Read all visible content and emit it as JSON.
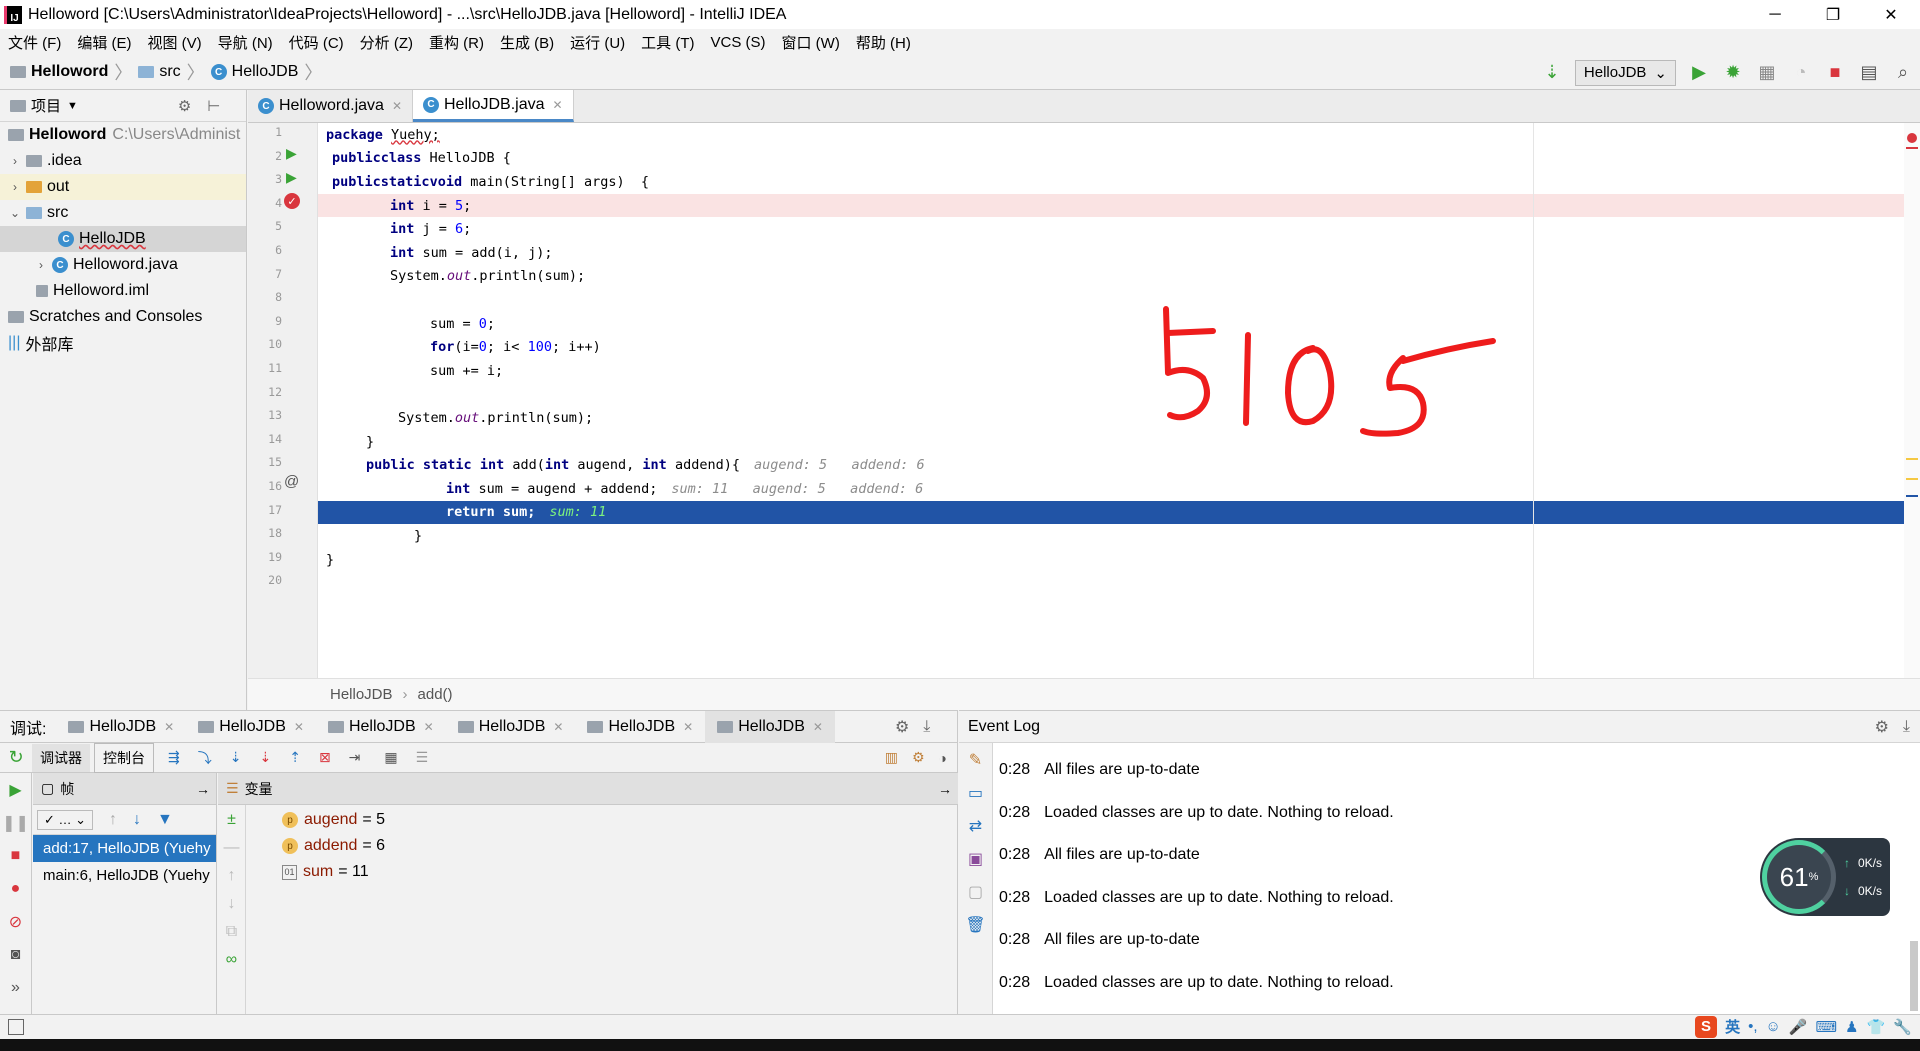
{
  "window": {
    "title": "Helloword [C:\\Users\\Administrator\\IdeaProjects\\Helloword] - ...\\src\\HelloJDB.java [Helloword] - IntelliJ IDEA"
  },
  "menu": [
    "文件 (F)",
    "编辑 (E)",
    "视图 (V)",
    "导航 (N)",
    "代码 (C)",
    "分析 (Z)",
    "重构 (R)",
    "生成 (B)",
    "运行 (U)",
    "工具 (T)",
    "VCS (S)",
    "窗口 (W)",
    "帮助 (H)"
  ],
  "breadcrumb": {
    "project": "Helloword",
    "folder": "src",
    "file": "HelloJDB"
  },
  "toolbar": {
    "run_config": "HelloJDB"
  },
  "project_panel": {
    "title": "项目",
    "items": [
      {
        "label": "Helloword",
        "hint": "C:\\Users\\Administ"
      },
      {
        "label": ".idea"
      },
      {
        "label": "out"
      },
      {
        "label": "src"
      },
      {
        "label": "HelloJDB"
      },
      {
        "label": "Helloword.java"
      },
      {
        "label": "Helloword.iml"
      },
      {
        "label": "Scratches and Consoles"
      },
      {
        "label": "外部库"
      }
    ]
  },
  "editor": {
    "tabs": [
      "Helloword.java",
      "HelloJDB.java"
    ],
    "line_numbers": [
      "1",
      "2",
      "3",
      "4",
      "5",
      "6",
      "7",
      "8",
      "9",
      "10",
      "11",
      "12",
      "13",
      "14",
      "15",
      "16",
      "17",
      "18",
      "19",
      "20"
    ],
    "lines": [
      "package Yuehy;",
      "public class HelloJDB {",
      "public static void main(String[] args)  {",
      "int i = 5;",
      "int j = 6;",
      "int sum = add(i, j);",
      "System.out.println(sum);",
      "",
      "sum = 0;",
      "for(i=0; i< 100; i++)",
      "sum += i;",
      "",
      "System.out.println(sum);",
      "}",
      "public static int add(int augend, int addend){",
      "int sum = augend + addend;",
      "return sum;",
      "}",
      "}",
      ""
    ],
    "hints": {
      "line15": "augend: 5   addend: 6",
      "line16": "sum: 11   augend: 5   addend: 6",
      "line17": "sum: 11"
    },
    "bottom_breadcrumb": [
      "HelloJDB",
      "add()"
    ],
    "handwriting": "5105"
  },
  "debug": {
    "label": "调试:",
    "tabs": [
      "HelloJDB",
      "HelloJDB",
      "HelloJDB",
      "HelloJDB",
      "HelloJDB",
      "HelloJDB"
    ],
    "subtabs": [
      "调试器",
      "控制台"
    ],
    "frames_title": "帧",
    "variables_title": "变量",
    "frames": [
      "add:17, HelloJDB (Yuehy",
      "main:6, HelloJDB (Yuehy"
    ],
    "variables": [
      {
        "name": "augend",
        "value": "= 5",
        "badge": "p"
      },
      {
        "name": "addend",
        "value": "= 6",
        "badge": "p"
      },
      {
        "name": "sum",
        "value": "= 11",
        "badge": "01"
      }
    ]
  },
  "event_log": {
    "title": "Event Log",
    "entries": [
      {
        "time": "0:28",
        "msg": "All files are up-to-date"
      },
      {
        "time": "0:28",
        "msg": "Loaded classes are up to date. Nothing to reload."
      },
      {
        "time": "0:28",
        "msg": "All files are up-to-date"
      },
      {
        "time": "0:28",
        "msg": "Loaded classes are up to date. Nothing to reload."
      },
      {
        "time": "0:28",
        "msg": "All files are up-to-date"
      },
      {
        "time": "0:28",
        "msg": "Loaded classes are up to date. Nothing to reload."
      }
    ]
  },
  "speed_widget": {
    "percent": "61",
    "pct_sign": "%",
    "up": "0K/s",
    "down": "0K/s"
  },
  "ime": {
    "lang": "英"
  },
  "colors": {
    "accent": "#2154a6",
    "breakpoint": "#d9363e",
    "run": "#3aa336"
  }
}
